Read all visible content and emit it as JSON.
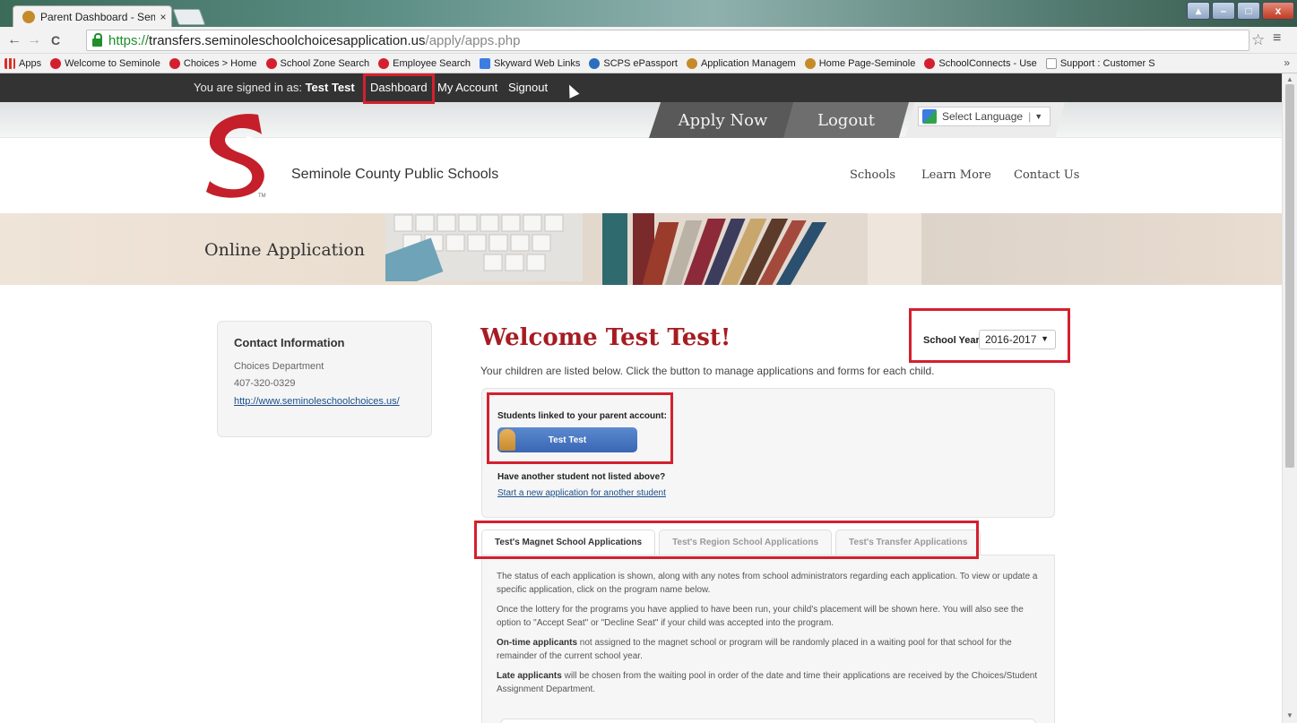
{
  "browser": {
    "tab_title": "Parent Dashboard - Semi",
    "tab_close": "×",
    "url_proto": "https://",
    "url_host": "transfers.seminoleschoolchoicesapplication.us",
    "url_path": "/apply/apps.php",
    "back_icon": "←",
    "forward_icon": "→",
    "reload_icon": "C",
    "star_icon": "☆",
    "menu_icon": "≡",
    "bookmarks": [
      {
        "label": "Apps",
        "icon_color": "#d93025"
      },
      {
        "label": "Welcome to Seminole",
        "icon_color": "#d4202e"
      },
      {
        "label": "Choices > Home",
        "icon_color": "#d4202e"
      },
      {
        "label": "School Zone Search",
        "icon_color": "#d4202e"
      },
      {
        "label": "Employee Search",
        "icon_color": "#d4202e"
      },
      {
        "label": "Skyward Web Links",
        "icon_color": "#3b7de3"
      },
      {
        "label": "SCPS ePassport",
        "icon_color": "#2a6ebd"
      },
      {
        "label": "Application Managem",
        "icon_color": "#c58b2a"
      },
      {
        "label": "Home Page-Seminole",
        "icon_color": "#c58b2a"
      },
      {
        "label": "SchoolConnects - Use",
        "icon_color": "#d4202e"
      },
      {
        "label": "Support : Customer S",
        "icon_color": "#999999"
      }
    ],
    "bookmarks_more": "»"
  },
  "topbar": {
    "signed_prefix": "You are signed in as:",
    "user_name": "Test Test",
    "dashboard": "Dashboard",
    "my_account": "My Account",
    "signout": "Signout"
  },
  "header": {
    "apply_now": "Apply Now",
    "logout": "Logout",
    "language": "Select Language",
    "language_caret": "▼",
    "site_name": "Seminole County Public Schools",
    "logo_tm": "TM",
    "nav": [
      "Schools",
      "Learn More",
      "Contact Us"
    ]
  },
  "banner": {
    "title": "Online Application"
  },
  "contact": {
    "heading": "Contact Information",
    "dept": "Choices Department",
    "phone": "407-320-0329",
    "url": "http://www.seminoleschoolchoices.us/"
  },
  "main": {
    "welcome": "Welcome Test Test!",
    "school_year_label": "School Year:",
    "school_year_value": "2016-2017",
    "intro": "Your children are listed below. Click the button to manage applications and forms for each child.",
    "students_label": "Students linked to your parent account:",
    "student_name": "Test Test",
    "another_label": "Have another student not listed above?",
    "new_app_link": "Start a new application for another student"
  },
  "tabs": [
    {
      "label": "Test's Magnet School Applications",
      "active": true
    },
    {
      "label": "Test's Region School Applications",
      "active": false
    },
    {
      "label": "Test's Transfer Applications",
      "active": false
    }
  ],
  "tab_content": {
    "p1": "The status of each application is shown, along with any notes from school administrators regarding each application. To view or update a specific application, click on the program name below.",
    "p2": "Once the lottery for the programs you have applied to have been run, your child's placement will be shown here. You will also see the option to \"Accept Seat\" or \"Decline Seat\" if your child was accepted into the program.",
    "p3_bold": "On-time applicants",
    "p3_rest": " not assigned to the magnet school or program will be randomly placed in a waiting pool for that school for the remainder of the current school year.",
    "p4_bold": "Late applicants",
    "p4_rest": " will be chosen from the waiting pool in order of the date and time their applications are received by the Choices/Student Assignment Department."
  },
  "colors": {
    "brand_red": "#a61c22",
    "highlight_red": "#d4202e",
    "topbar": "#333333",
    "student_button": "#3a66b3"
  }
}
